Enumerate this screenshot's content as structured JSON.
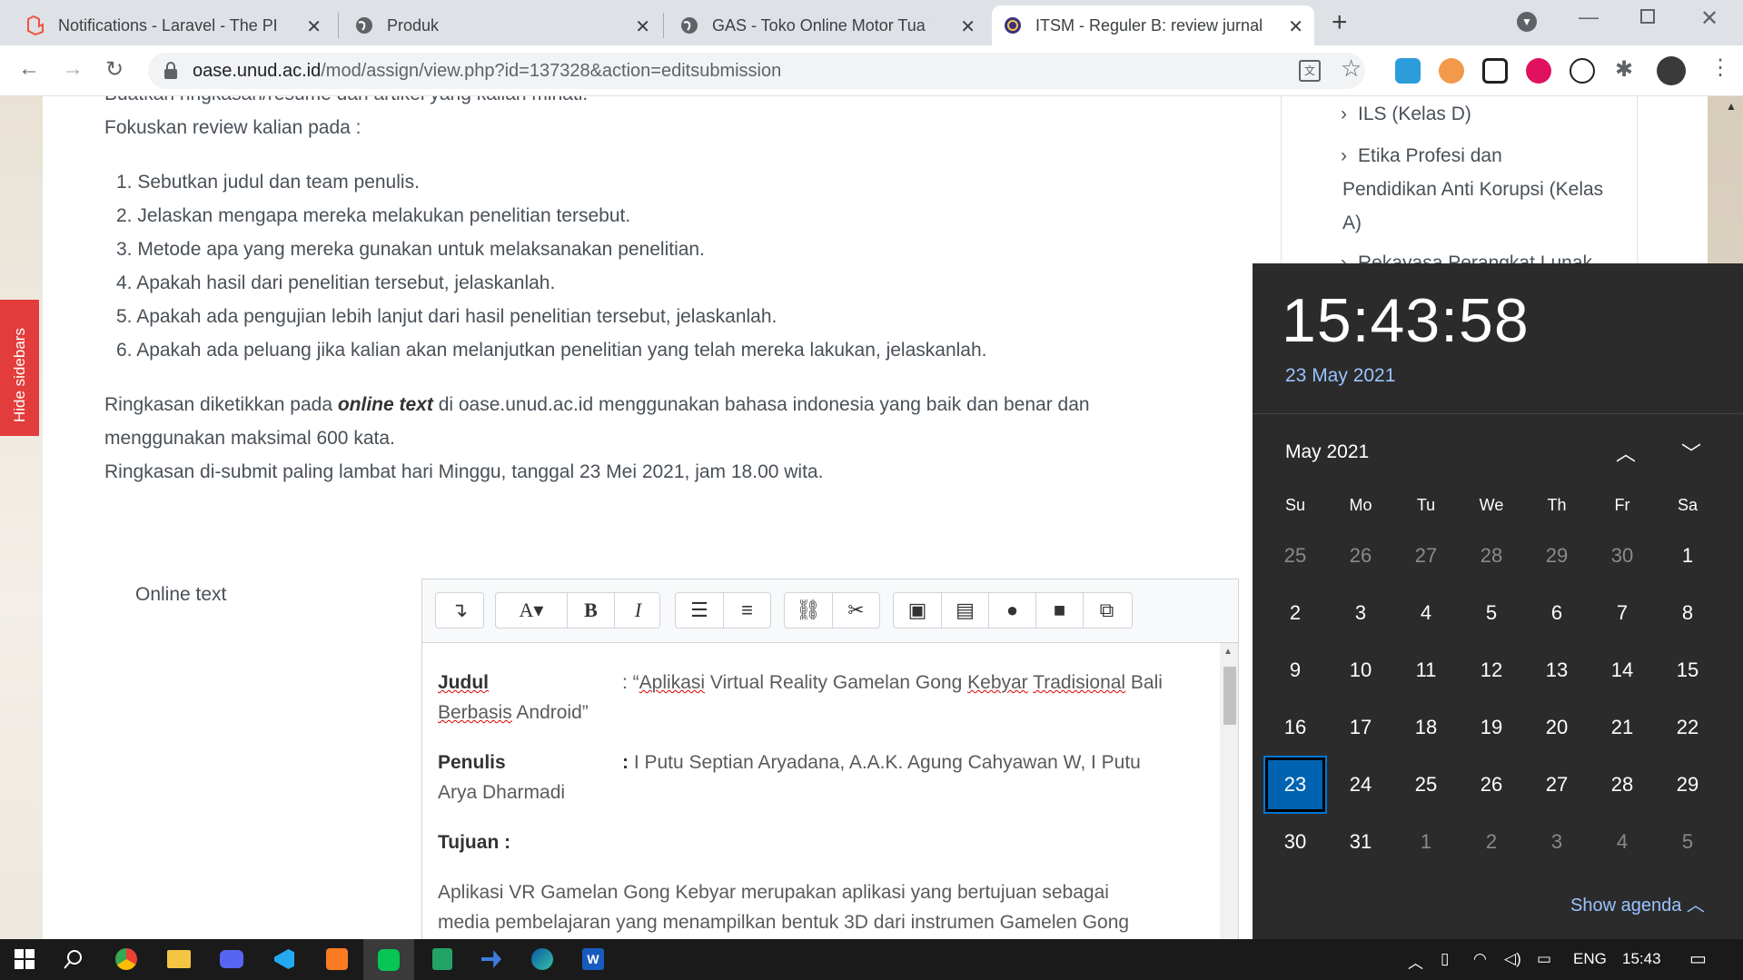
{
  "browser": {
    "tabs": [
      {
        "title": "Notifications - Laravel - The PHP",
        "icon": "laravel-icon",
        "active": false
      },
      {
        "title": "Produk",
        "icon": "globe-icon",
        "active": false
      },
      {
        "title": "GAS - Toko Online Motor Tua Ter",
        "icon": "globe-icon",
        "active": false
      },
      {
        "title": "ITSM - Reguler B: review jurnal ke",
        "icon": "unud-logo-icon",
        "active": true
      }
    ],
    "url_domain": "oase.unud.ac.id",
    "url_path": "/mod/assign/view.php?id=137328&action=editsubmission"
  },
  "sidebar_toggle": "Hide sidebars",
  "instructions": {
    "partial_line": "Buatkan ringkasan/resume dari artikel yang kalian minati.",
    "focus_heading": "Fokuskan review kalian pada :",
    "items": [
      "1. Sebutkan judul dan team penulis.",
      "2. Jelaskan mengapa mereka melakukan penelitian tersebut.",
      "3. Metode apa yang mereka gunakan untuk melaksanakan penelitian.",
      "4. Apakah hasil dari penelitian tersebut, jelaskanlah.",
      "5. Apakah ada pengujian lebih lanjut dari hasil penelitian tersebut, jelaskanlah.",
      "6. Apakah ada peluang jika kalian akan melanjutkan penelitian yang telah mereka lakukan, jelaskanlah."
    ],
    "para1_pre": "Ringkasan diketikkan pada ",
    "para1_em": "online text",
    "para1_post": " di oase.unud.ac.id menggunakan bahasa indonesia yang baik dan benar dan",
    "para1_line2": "menggunakan maksimal 600 kata.",
    "para2": "Ringkasan di-submit paling lambat hari Minggu, tanggal 23 Mei 2021, jam 18.00 wita."
  },
  "course_sidebar": {
    "items": [
      "ILS (Kelas D)",
      "Etika Profesi dan",
      "Pendidikan Anti Korupsi (Kelas",
      "A)",
      "Rekayasa Perangkat Lunak"
    ]
  },
  "editor": {
    "label": "Online text",
    "judul_label": "Judul",
    "judul_sep": ": “",
    "judul_w1": "Aplikasi",
    "judul_w2": " Virtual Reality Gamelan Gong ",
    "judul_w3": "Kebyar",
    "judul_w4": " ",
    "judul_w5": "Tradisional",
    "judul_w6": " Bali",
    "judul_line2_a": "Berbasis",
    "judul_line2_b": " Android”",
    "penulis_label": "Penulis",
    "penulis_sep": ": ",
    "penulis_value": "I Putu Septian Aryadana, A.A.K. Agung Cahyawan W, I Putu",
    "penulis_line2": "Arya Dharmadi",
    "tujuan_label": "Tujuan :",
    "body_line1": "Aplikasi  VR Gamelan  Gong Kebyar merupakan  aplikasi  yang bertujuan sebagai",
    "body_line2": "media pembelajaran  yang  menampilkan  bentuk  3D dari  instrumen Gamelen  Gong"
  },
  "calendar": {
    "time": "15:43:58",
    "date": "23 May 2021",
    "month_label": "May 2021",
    "weekdays": [
      "Su",
      "Mo",
      "Tu",
      "We",
      "Th",
      "Fr",
      "Sa"
    ],
    "days": [
      [
        "25",
        "26",
        "27",
        "28",
        "29",
        "30",
        "1"
      ],
      [
        "2",
        "3",
        "4",
        "5",
        "6",
        "7",
        "8"
      ],
      [
        "9",
        "10",
        "11",
        "12",
        "13",
        "14",
        "15"
      ],
      [
        "16",
        "17",
        "18",
        "19",
        "20",
        "21",
        "22"
      ],
      [
        "23",
        "24",
        "25",
        "26",
        "27",
        "28",
        "29"
      ],
      [
        "30",
        "31",
        "1",
        "2",
        "3",
        "4",
        "5"
      ]
    ],
    "today": "23",
    "show_agenda": "Show agenda"
  },
  "taskbar": {
    "lang": "ENG",
    "time": "15:43"
  },
  "colors": {
    "accent": "#0078d7",
    "today_bg": "#0063b1",
    "hide_sidebar_bg": "#e33c3c",
    "flyout_bg": "#2b2b2b"
  }
}
